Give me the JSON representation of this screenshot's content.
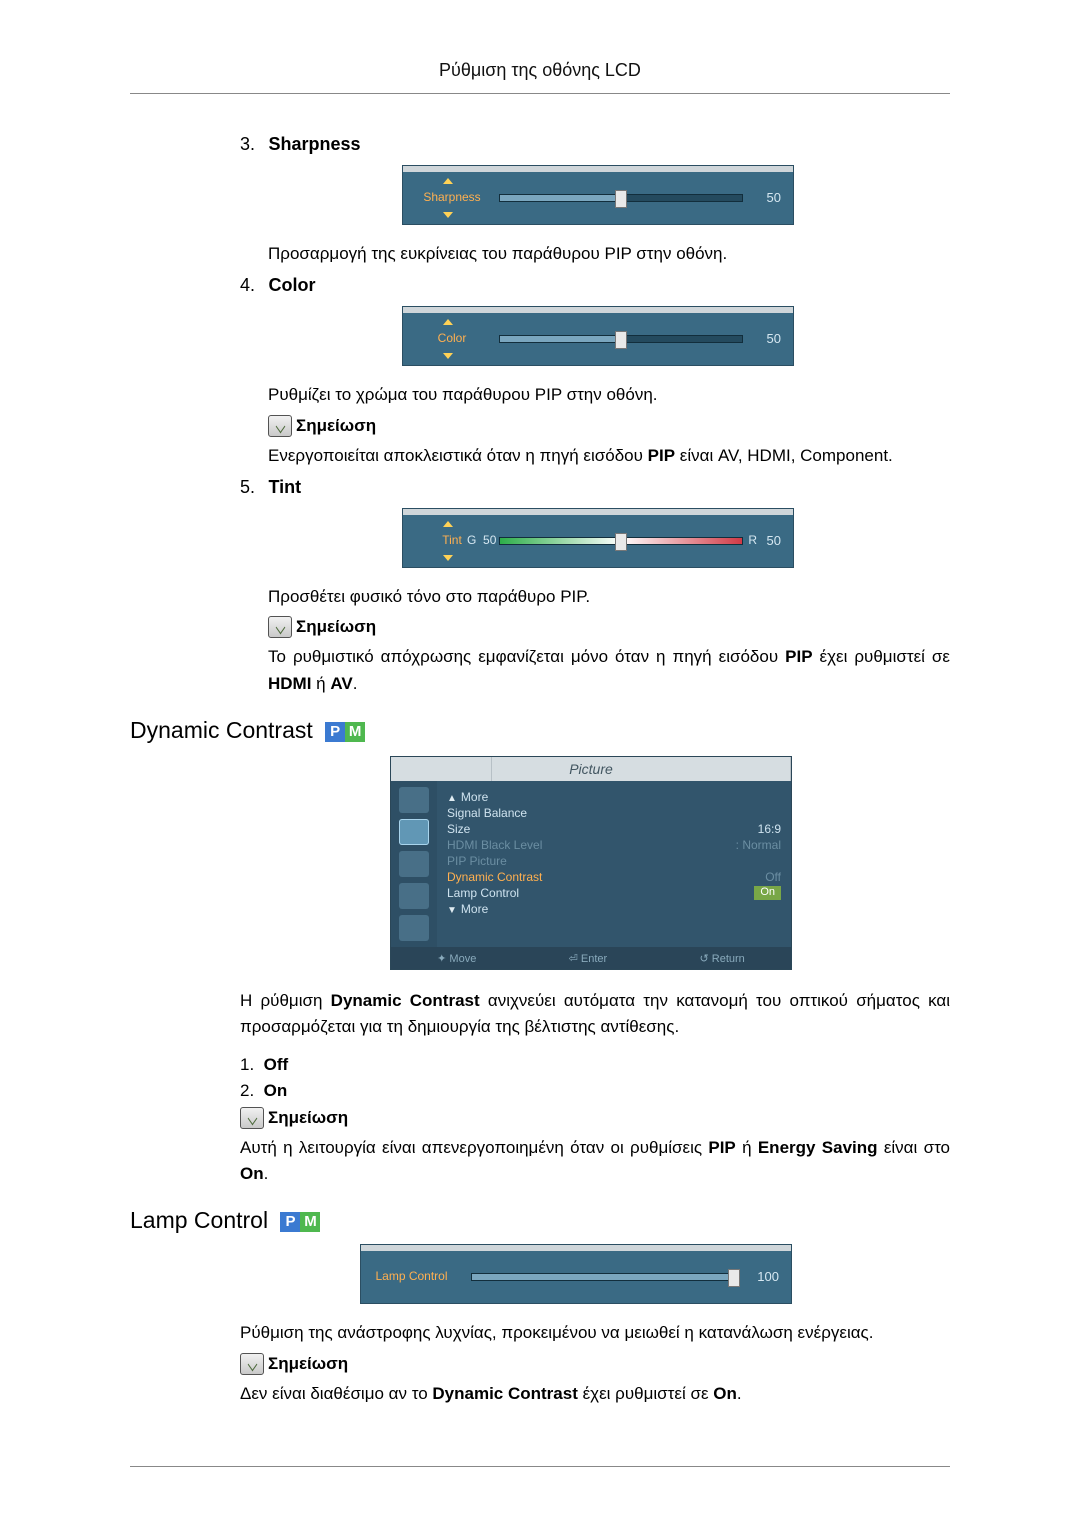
{
  "header": "Ρύθμιση της οθόνης LCD",
  "item3": {
    "num": "3.",
    "label": "Sharpness",
    "slider_label": "Sharpness",
    "value": "50",
    "desc": "Προσαρμογή της ευκρίνειας του παράθυρου PIP στην οθόνη."
  },
  "item4": {
    "num": "4.",
    "label": "Color",
    "slider_label": "Color",
    "value": "50",
    "desc": "Ρυθμίζει το χρώμα του παράθυρου PIP στην οθόνη.",
    "note_label": "Σημείωση",
    "note_text_prefix": "Ενεργοποιείται αποκλειστικά όταν η πηγή εισόδου ",
    "note_bold": "PIP",
    "note_text_suffix": " είναι AV, HDMI, Component."
  },
  "item5": {
    "num": "5.",
    "label": "Tint",
    "slider_label": "Tint",
    "g_label": "G",
    "g_value": "50",
    "r_label": "R",
    "r_value": "50",
    "desc": "Προσθέτει φυσικό τόνο στο παράθυρο PIP.",
    "note_label": "Σημείωση",
    "note_text_prefix": "Το ρυθμιστικό απόχρωσης εμφανίζεται μόνο όταν η πηγή εισόδου ",
    "note_bold1": "PIP",
    "note_text_mid": " έχει ρυθμιστεί σε ",
    "note_bold2": "HDMI",
    "note_text_or": " ή ",
    "note_bold3": "AV",
    "note_text_end": "."
  },
  "dynamic": {
    "title": "Dynamic Contrast",
    "menu_title": "Picture",
    "rows": {
      "more_up": "More",
      "signal_balance": "Signal Balance",
      "size": "Size",
      "size_val": "16:9",
      "hdmi_black": "HDMI Black Level",
      "hdmi_val": "Normal",
      "pip_picture": "PIP Picture",
      "dyn_contrast": "Dynamic Contrast",
      "dyn_val": "Off",
      "lamp_control": "Lamp Control",
      "lamp_val": "On",
      "more_down": "More"
    },
    "footer": {
      "move": "Move",
      "enter": "Enter",
      "return": "Return"
    },
    "desc_prefix": "Η ρύθμιση ",
    "desc_bold": "Dynamic Contrast",
    "desc_suffix": " ανιχνεύει αυτόματα την κατανομή του οπτικού σήματος και προσαρμόζεται για τη δημιουργία της βέλτιστης αντίθεσης.",
    "opt1_num": "1.",
    "opt1": "Off",
    "opt2_num": "2.",
    "opt2": "On",
    "note_label": "Σημείωση",
    "note_prefix": "Αυτή η λειτουργία είναι απενεργοποιημένη όταν οι ρυθμίσεις ",
    "note_b1": "PIP",
    "note_or": " ή ",
    "note_b2": "Energy Saving",
    "note_mid": " είναι στο ",
    "note_b3": "On",
    "note_end": "."
  },
  "lamp": {
    "title": "Lamp Control",
    "slider_label": "Lamp Control",
    "value": "100",
    "desc": "Ρύθμιση της ανάστροφης λυχνίας, προκειμένου να μειωθεί η κατανάλωση ενέργειας.",
    "note_label": "Σημείωση",
    "note_prefix": "Δεν είναι διαθέσιμο αν το ",
    "note_b1": "Dynamic Contrast",
    "note_mid": " έχει ρυθμιστεί σε ",
    "note_b2": "On",
    "note_end": "."
  }
}
